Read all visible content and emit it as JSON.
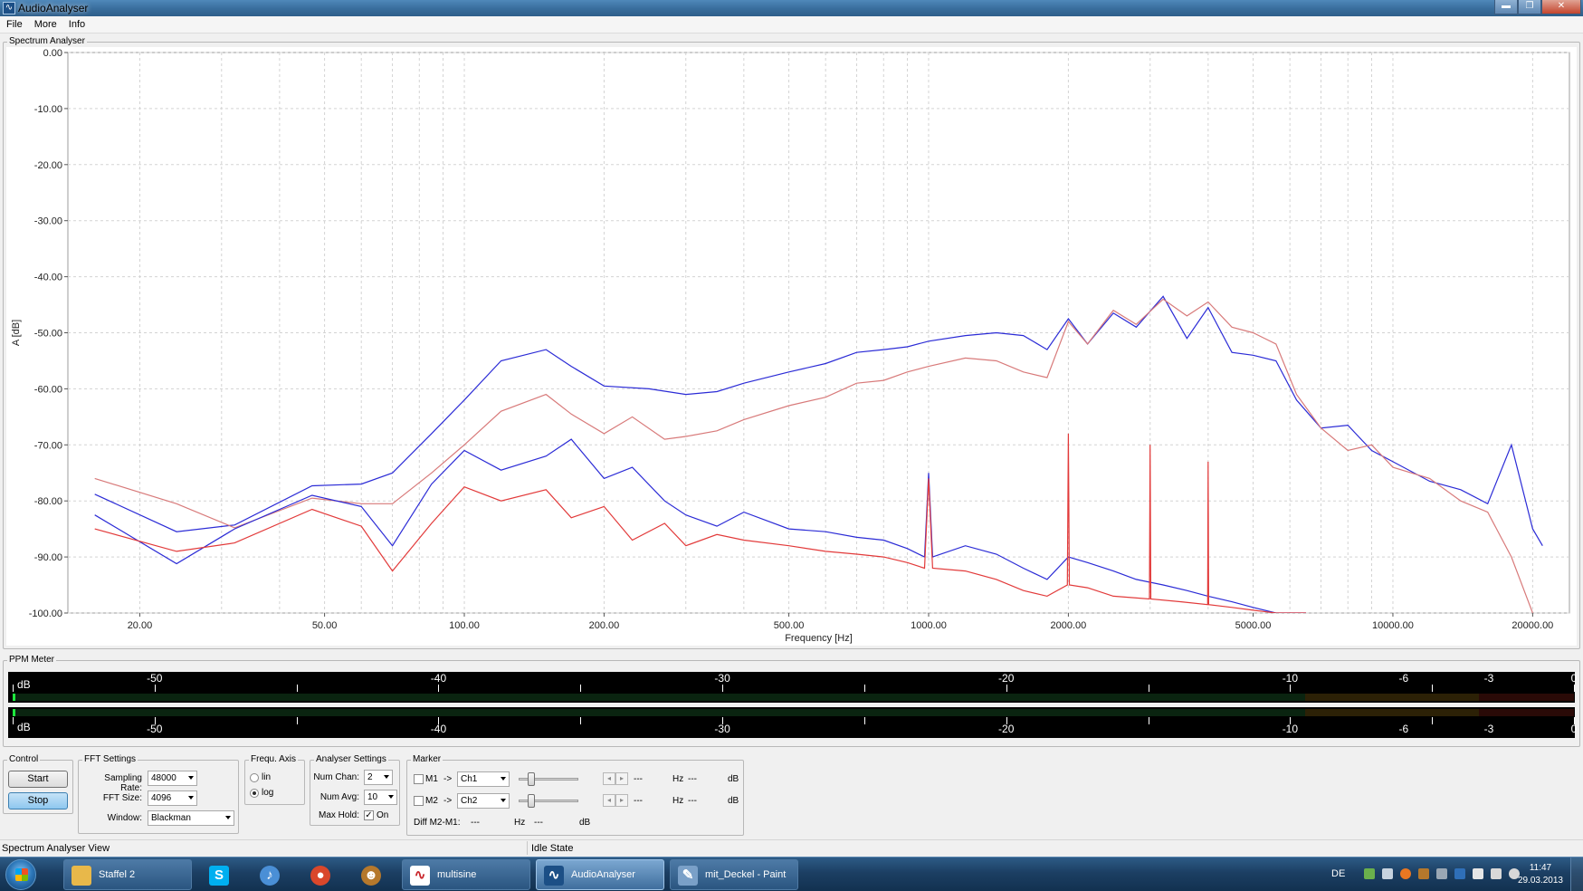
{
  "window": {
    "title": "AudioAnalyser",
    "app_icon": "audioanalyser-icon",
    "minimize": "▬",
    "maximize": "❐",
    "close": "✕"
  },
  "menu": [
    "File",
    "More",
    "Info"
  ],
  "spectrum": {
    "group_label": "Spectrum Analyser"
  },
  "chart_data": {
    "type": "line",
    "xlabel": "Frequency [Hz]",
    "ylabel": "A [dB]",
    "x_scale": "log",
    "xlim": [
      14,
      24000
    ],
    "ylim": [
      -100,
      0
    ],
    "x_ticks": [
      "20.00",
      "50.00",
      "100.00",
      "200.00",
      "500.00",
      "1000.00",
      "2000.00",
      "5000.00",
      "10000.00",
      "20000.00"
    ],
    "x_tick_values": [
      20,
      50,
      100,
      200,
      500,
      1000,
      2000,
      5000,
      10000,
      20000
    ],
    "y_ticks": [
      "0.00",
      "-10.00",
      "-20.00",
      "-30.00",
      "-40.00",
      "-50.00",
      "-60.00",
      "-70.00",
      "-80.00",
      "-90.00",
      "-100.00"
    ],
    "y_tick_values": [
      0,
      -10,
      -20,
      -30,
      -40,
      -50,
      -60,
      -70,
      -80,
      -90,
      -100
    ],
    "grid": true,
    "series": [
      {
        "color": "#2b2bd6",
        "x": [
          16,
          24,
          32,
          47,
          60,
          70,
          85,
          100,
          120,
          150,
          170,
          200,
          250,
          300,
          350,
          400,
          500,
          600,
          700,
          800,
          900,
          1000,
          1200,
          1400,
          1600,
          1800,
          2000,
          2200,
          2500,
          2800,
          3200,
          3600,
          4000,
          4500,
          5000,
          5600,
          6200,
          7000,
          8000,
          9000,
          10000,
          12000,
          14000,
          16000,
          18000,
          20000,
          21000
        ],
        "y": [
          -78.8,
          -85.5,
          -84.3,
          -77.3,
          -77.0,
          -75.0,
          -68.0,
          -62.0,
          -55.0,
          -53.0,
          -56.0,
          -59.5,
          -60.0,
          -61.0,
          -60.5,
          -59.0,
          -57.0,
          -55.5,
          -53.5,
          -53.0,
          -52.5,
          -51.5,
          -50.5,
          -50.0,
          -50.5,
          -53.0,
          -47.5,
          -52.0,
          -46.5,
          -49.0,
          -43.5,
          -51.0,
          -45.5,
          -53.5,
          -54.0,
          -55.0,
          -62.0,
          -67.0,
          -66.5,
          -71.0,
          -73.0,
          -76.5,
          -78.0,
          -80.5,
          -70.0,
          -85.0,
          -88.0
        ]
      },
      {
        "color": "#d87a7a",
        "x": [
          16,
          24,
          32,
          47,
          60,
          70,
          85,
          100,
          120,
          150,
          170,
          200,
          230,
          270,
          300,
          350,
          400,
          500,
          600,
          700,
          800,
          900,
          1000,
          1200,
          1400,
          1600,
          1800,
          2000,
          2200,
          2500,
          2800,
          3200,
          3600,
          4000,
          4500,
          5000,
          5600,
          6200,
          7000,
          8000,
          9000,
          10000,
          12000,
          14000,
          16000,
          18000,
          20000
        ],
        "y": [
          -76.0,
          -80.5,
          -84.8,
          -79.5,
          -80.5,
          -80.5,
          -75.0,
          -70.0,
          -64.0,
          -61.0,
          -64.5,
          -68.0,
          -65.0,
          -69.0,
          -68.5,
          -67.5,
          -65.5,
          -63.0,
          -61.5,
          -59.0,
          -58.5,
          -57.0,
          -56.0,
          -54.5,
          -55.0,
          -57.0,
          -58.0,
          -48.0,
          -52.0,
          -46.0,
          -48.5,
          -44.0,
          -47.0,
          -44.5,
          -49.0,
          -50.0,
          -52.0,
          -61.0,
          -67.0,
          -71.0,
          -70.0,
          -74.0,
          -76.0,
          -80.0,
          -82.0,
          -90.0,
          -100.0
        ]
      },
      {
        "color": "#2b2bd6",
        "x": [
          16,
          24,
          32,
          47,
          60,
          70,
          85,
          100,
          120,
          150,
          170,
          200,
          230,
          270,
          300,
          350,
          400,
          500,
          600,
          700,
          800,
          900,
          980,
          1000,
          1020,
          1200,
          1400,
          1600,
          1800,
          2000,
          2200,
          2500,
          2800,
          3200,
          3600,
          4000,
          4500,
          5000,
          5600,
          6500
        ],
        "y": [
          -82.5,
          -91.2,
          -85.0,
          -79.0,
          -81.0,
          -88.0,
          -77.0,
          -71.0,
          -74.5,
          -72.0,
          -69.0,
          -76.0,
          -74.0,
          -80.0,
          -82.5,
          -84.5,
          -82.0,
          -85.0,
          -85.5,
          -86.5,
          -87.0,
          -88.5,
          -90.0,
          -75.0,
          -90.0,
          -88.0,
          -89.5,
          -92.0,
          -94.0,
          -90.0,
          -91.0,
          -92.5,
          -94.0,
          -95.0,
          -96.0,
          -97.0,
          -98.0,
          -99.0,
          -100.0,
          -100.0
        ]
      },
      {
        "color": "#e23a3a",
        "x": [
          16,
          24,
          32,
          47,
          60,
          70,
          85,
          100,
          120,
          150,
          170,
          200,
          230,
          270,
          300,
          350,
          400,
          500,
          600,
          700,
          800,
          900,
          980,
          1000,
          1020,
          1200,
          1400,
          1600,
          1800,
          1990,
          2000,
          2010,
          2200,
          2500,
          2990,
          3000,
          3010,
          3500,
          3990,
          4000,
          4010,
          4500,
          5000,
          5600,
          6500
        ],
        "y": [
          -85.0,
          -89.0,
          -87.5,
          -81.5,
          -84.5,
          -92.5,
          -84.0,
          -77.5,
          -80.0,
          -78.0,
          -83.0,
          -81.0,
          -87.0,
          -84.0,
          -88.0,
          -86.0,
          -87.0,
          -88.0,
          -89.0,
          -89.5,
          -90.0,
          -91.0,
          -92.0,
          -76.0,
          -92.0,
          -92.5,
          -94.0,
          -96.0,
          -97.0,
          -95.0,
          -68.0,
          -95.0,
          -95.5,
          -97.0,
          -97.5,
          -70.0,
          -97.5,
          -98.0,
          -98.5,
          -73.0,
          -98.5,
          -99.0,
          -99.5,
          -100.0,
          -100.0
        ]
      }
    ]
  },
  "ppm": {
    "group_label": "PPM Meter",
    "db_label": "dB",
    "scale": [
      "-50",
      "-40",
      "-30",
      "-20",
      "-10",
      "-6",
      "-3",
      "0"
    ],
    "scale_values": [
      -50,
      -40,
      -30,
      -20,
      -10,
      -6,
      -3,
      0
    ],
    "ch1_level_fraction": 0.002,
    "ch2_level_fraction": 0.002
  },
  "control": {
    "label": "Control",
    "start": "Start",
    "stop": "Stop"
  },
  "fft": {
    "label": "FFT Settings",
    "sampling_rate_label": "Sampling Rate:",
    "sampling_rate": "48000",
    "fft_size_label": "FFT Size:",
    "fft_size": "4096",
    "window_label": "Window:",
    "window": "Blackman"
  },
  "frequ_axis": {
    "label": "Frequ. Axis",
    "lin": "lin",
    "log": "log",
    "selected": "log"
  },
  "analyser": {
    "label": "Analyser Settings",
    "num_chan_label": "Num Chan:",
    "num_chan": "2",
    "num_avg_label": "Num Avg:",
    "num_avg": "10",
    "max_hold_label": "Max Hold:",
    "max_hold_value": "On",
    "max_hold_checked": true
  },
  "marker": {
    "label": "Marker",
    "m1": {
      "name": "M1",
      "arrow": "->",
      "channel": "Ch1",
      "value": "---",
      "hz_label": "Hz",
      "hz_value": "---",
      "db_label": "dB"
    },
    "m2": {
      "name": "M2",
      "arrow": "->",
      "channel": "Ch2",
      "value": "---",
      "hz_label": "Hz",
      "hz_value": "---",
      "db_label": "dB"
    },
    "diff_label": "Diff M2-M1:",
    "diff_value": "---",
    "diff_hz_label": "Hz",
    "diff_hz_value": "---",
    "diff_db_label": "dB"
  },
  "status": {
    "view": "Spectrum Analyser View",
    "state": "Idle State"
  },
  "taskbar": {
    "tasks": [
      {
        "label": "Staffel 2",
        "icon": "folder-icon",
        "color": "#e8b84a"
      },
      {
        "label": "",
        "icon": "skype-icon",
        "color": "#00aff0"
      },
      {
        "label": "",
        "icon": "itunes-icon",
        "color": "#4a8fd6"
      },
      {
        "label": "",
        "icon": "chrome-icon",
        "color": "#d9472b"
      },
      {
        "label": "",
        "icon": "monkey-icon",
        "color": "#b5782c"
      },
      {
        "label": "multisine",
        "icon": "multisine-icon",
        "color": "#c8242a"
      },
      {
        "label": "AudioAnalyser",
        "icon": "audioanalyser-icon",
        "color": "#1c4f86"
      },
      {
        "label": "mit_Deckel - Paint",
        "icon": "paint-icon",
        "color": "#7aa0c8"
      }
    ],
    "language": "DE",
    "time": "11:47",
    "date": "29.03.2013"
  }
}
